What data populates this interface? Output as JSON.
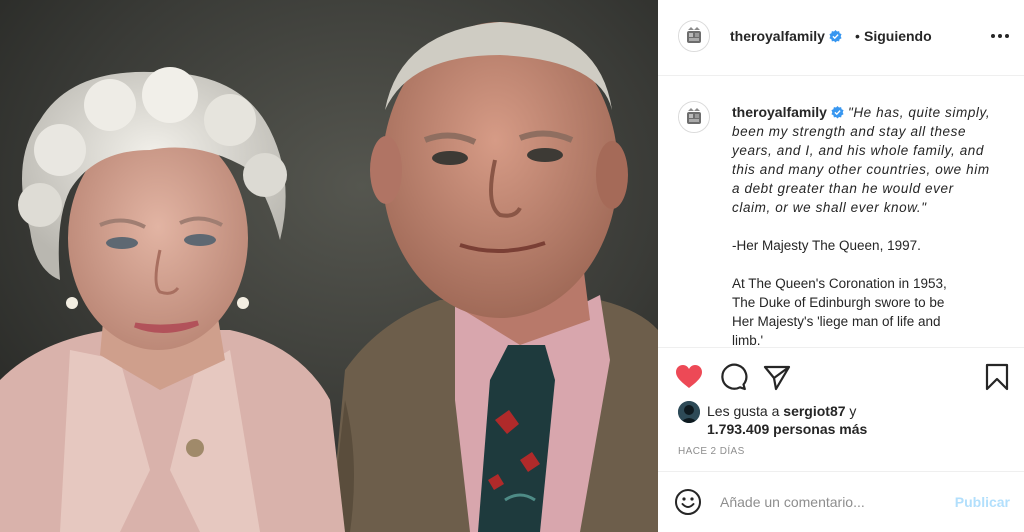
{
  "post": {
    "image_alt_colors": {
      "background": "#3c3d3a"
    }
  },
  "header": {
    "username": "theroyalfamily",
    "separator": "•",
    "follow_status": "Siguiendo"
  },
  "caption": {
    "username": "theroyalfamily",
    "quote_lines": [
      "\"He has, quite simply,",
      "been my strength and stay all these",
      "years, and I, and his whole family, and",
      "this and many other countries, owe him",
      "a debt greater than he would ever",
      "claim, or we shall ever know.\""
    ],
    "attribution": "-Her Majesty The Queen, 1997.",
    "body_lines": [
      "At The Queen's Coronation in 1953,",
      "The Duke of Edinburgh swore to be",
      "Her Majesty's 'liege man of life and",
      "limb.'"
    ]
  },
  "likes": {
    "prefix": "Les gusta a",
    "user": "sergiot87",
    "conjunction": "y",
    "count_text": "1.793.409 personas más"
  },
  "timeago": "HACE 2 DÍAS",
  "comment": {
    "placeholder": "Añade un comentario...",
    "post_label": "Publicar"
  },
  "colors": {
    "like": "#ed4956",
    "verified": "#3897f0",
    "publish_disabled": "#b2dffc"
  }
}
